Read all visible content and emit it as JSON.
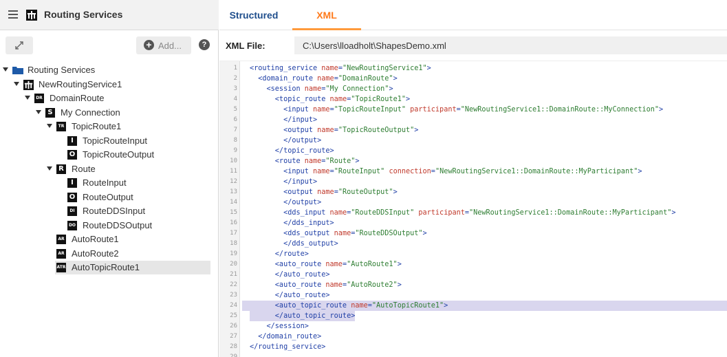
{
  "app": {
    "title": "Routing Services",
    "add_label": "Add...",
    "help_glyph": "?",
    "add_glyph": "+"
  },
  "tree": [
    {
      "label": "Routing Services",
      "icon": "folder-icon",
      "badge": "",
      "caret": true,
      "selected": false
    },
    {
      "label": "NewRoutingService1",
      "icon": "routing-service-icon",
      "badge": "",
      "caret": true,
      "selected": false
    },
    {
      "label": "DomainRoute",
      "icon": "domain-route-icon",
      "badge": "DR",
      "caret": true,
      "selected": false
    },
    {
      "label": "My Connection",
      "icon": "session-icon",
      "badge": "S",
      "caret": true,
      "selected": false
    },
    {
      "label": "TopicRoute1",
      "icon": "topic-route-icon",
      "badge": "TR",
      "caret": true,
      "selected": false
    },
    {
      "label": "TopicRouteInput",
      "icon": "input-icon",
      "badge": "I",
      "caret": false,
      "selected": false
    },
    {
      "label": "TopicRouteOutput",
      "icon": "output-icon",
      "badge": "O",
      "caret": false,
      "selected": false
    },
    {
      "label": "Route",
      "icon": "route-icon",
      "badge": "R",
      "caret": true,
      "selected": false
    },
    {
      "label": "RouteInput",
      "icon": "input-icon",
      "badge": "I",
      "caret": false,
      "selected": false
    },
    {
      "label": "RouteOutput",
      "icon": "output-icon",
      "badge": "O",
      "caret": false,
      "selected": false
    },
    {
      "label": "RouteDDSInput",
      "icon": "dds-input-icon",
      "badge": "DI",
      "caret": false,
      "selected": false
    },
    {
      "label": "RouteDDSOutput",
      "icon": "dds-output-icon",
      "badge": "DO",
      "caret": false,
      "selected": false
    },
    {
      "label": "AutoRoute1",
      "icon": "auto-route-icon",
      "badge": "AR",
      "caret": false,
      "selected": false
    },
    {
      "label": "AutoRoute2",
      "icon": "auto-route-icon",
      "badge": "AR",
      "caret": false,
      "selected": false
    },
    {
      "label": "AutoTopicRoute1",
      "icon": "auto-topic-route-icon",
      "badge": "ATR",
      "caret": false,
      "selected": true
    }
  ],
  "tabs": {
    "structured": "Structured",
    "xml": "XML",
    "active": "xml"
  },
  "file": {
    "label": "XML File:",
    "path": "C:\\Users\\lloadholt\\ShapesDemo.xml"
  },
  "editor": {
    "highlighted_lines": [
      24,
      25
    ],
    "lines": [
      [
        [
          "t",
          "<routing_service "
        ],
        [
          "a",
          "name"
        ],
        [
          "t",
          "="
        ],
        [
          "v",
          "\"NewRoutingService1\""
        ],
        [
          "t",
          ">"
        ]
      ],
      [
        [
          "t",
          "  <domain_route "
        ],
        [
          "a",
          "name"
        ],
        [
          "t",
          "="
        ],
        [
          "v",
          "\"DomainRoute\""
        ],
        [
          "t",
          ">"
        ]
      ],
      [
        [
          "t",
          "    <session "
        ],
        [
          "a",
          "name"
        ],
        [
          "t",
          "="
        ],
        [
          "v",
          "\"My Connection\""
        ],
        [
          "t",
          ">"
        ]
      ],
      [
        [
          "t",
          "      <topic_route "
        ],
        [
          "a",
          "name"
        ],
        [
          "t",
          "="
        ],
        [
          "v",
          "\"TopicRoute1\""
        ],
        [
          "t",
          ">"
        ]
      ],
      [
        [
          "t",
          "        <input "
        ],
        [
          "a",
          "name"
        ],
        [
          "t",
          "="
        ],
        [
          "v",
          "\"TopicRouteInput\""
        ],
        [
          "t",
          " "
        ],
        [
          "a",
          "participant"
        ],
        [
          "t",
          "="
        ],
        [
          "v",
          "\"NewRoutingService1::DomainRoute::MyConnection\""
        ],
        [
          "t",
          ">"
        ]
      ],
      [
        [
          "t",
          "        </input>"
        ]
      ],
      [
        [
          "t",
          "        <output "
        ],
        [
          "a",
          "name"
        ],
        [
          "t",
          "="
        ],
        [
          "v",
          "\"TopicRouteOutput\""
        ],
        [
          "t",
          ">"
        ]
      ],
      [
        [
          "t",
          "        </output>"
        ]
      ],
      [
        [
          "t",
          "      </topic_route>"
        ]
      ],
      [
        [
          "t",
          "      <route "
        ],
        [
          "a",
          "name"
        ],
        [
          "t",
          "="
        ],
        [
          "v",
          "\"Route\""
        ],
        [
          "t",
          ">"
        ]
      ],
      [
        [
          "t",
          "        <input "
        ],
        [
          "a",
          "name"
        ],
        [
          "t",
          "="
        ],
        [
          "v",
          "\"RouteInput\""
        ],
        [
          "t",
          " "
        ],
        [
          "a",
          "connection"
        ],
        [
          "t",
          "="
        ],
        [
          "v",
          "\"NewRoutingService1::DomainRoute::MyParticipant\""
        ],
        [
          "t",
          ">"
        ]
      ],
      [
        [
          "t",
          "        </input>"
        ]
      ],
      [
        [
          "t",
          "        <output "
        ],
        [
          "a",
          "name"
        ],
        [
          "t",
          "="
        ],
        [
          "v",
          "\"RouteOutput\""
        ],
        [
          "t",
          ">"
        ]
      ],
      [
        [
          "t",
          "        </output>"
        ]
      ],
      [
        [
          "t",
          "        <dds_input "
        ],
        [
          "a",
          "name"
        ],
        [
          "t",
          "="
        ],
        [
          "v",
          "\"RouteDDSInput\""
        ],
        [
          "t",
          " "
        ],
        [
          "a",
          "participant"
        ],
        [
          "t",
          "="
        ],
        [
          "v",
          "\"NewRoutingService1::DomainRoute::MyParticipant\""
        ],
        [
          "t",
          ">"
        ]
      ],
      [
        [
          "t",
          "        </dds_input>"
        ]
      ],
      [
        [
          "t",
          "        <dds_output "
        ],
        [
          "a",
          "name"
        ],
        [
          "t",
          "="
        ],
        [
          "v",
          "\"RouteDDSOutput\""
        ],
        [
          "t",
          ">"
        ]
      ],
      [
        [
          "t",
          "        </dds_output>"
        ]
      ],
      [
        [
          "t",
          "      </route>"
        ]
      ],
      [
        [
          "t",
          "      <auto_route "
        ],
        [
          "a",
          "name"
        ],
        [
          "t",
          "="
        ],
        [
          "v",
          "\"AutoRoute1\""
        ],
        [
          "t",
          ">"
        ]
      ],
      [
        [
          "t",
          "      </auto_route>"
        ]
      ],
      [
        [
          "t",
          "      <auto_route "
        ],
        [
          "a",
          "name"
        ],
        [
          "t",
          "="
        ],
        [
          "v",
          "\"AutoRoute2\""
        ],
        [
          "t",
          ">"
        ]
      ],
      [
        [
          "t",
          "      </auto_route>"
        ]
      ],
      [
        [
          "t",
          "      <auto_topic_route "
        ],
        [
          "a",
          "name"
        ],
        [
          "t",
          "="
        ],
        [
          "v",
          "\"AutoTopicRoute1\""
        ],
        [
          "t",
          ">"
        ]
      ],
      [
        [
          "t",
          "      </auto_topic_route>"
        ]
      ],
      [
        [
          "t",
          "    </session>"
        ]
      ],
      [
        [
          "t",
          "  </domain_route>"
        ]
      ],
      [
        [
          "t",
          "</routing_service>"
        ]
      ],
      [
        [
          "t",
          ""
        ]
      ],
      [
        [
          "t",
          ""
        ]
      ]
    ]
  }
}
